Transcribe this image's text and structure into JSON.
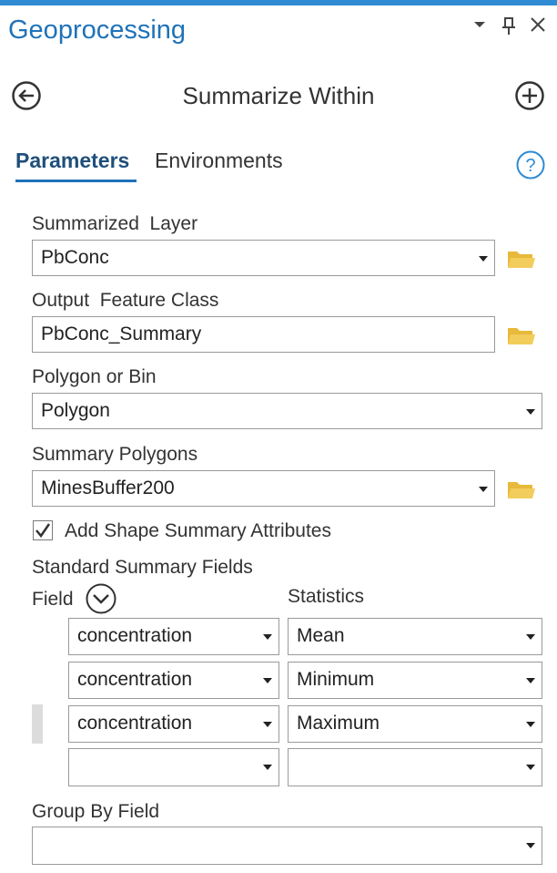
{
  "pane": {
    "title": "Geoprocessing",
    "controls": {
      "menu": "▾",
      "pin": "†",
      "close": "×"
    }
  },
  "tool": {
    "title": "Summarize Within"
  },
  "tabs": [
    {
      "label": "Parameters",
      "active": true
    },
    {
      "label": "Environments",
      "active": false
    }
  ],
  "params": {
    "summarized_layer": {
      "label": "Summarized  Layer",
      "value": "PbConc"
    },
    "output_feature_class": {
      "label": "Output  Feature Class",
      "value": "PbConc_Summary"
    },
    "polygon_or_bin": {
      "label": "Polygon or Bin",
      "value": "Polygon"
    },
    "summary_polygons": {
      "label": "Summary Polygons",
      "value": "MinesBuffer200"
    },
    "add_shape_summary": {
      "label": "Add Shape Summary Attributes",
      "checked": true
    },
    "standard_summary_fields": {
      "label": "Standard Summary Fields",
      "field_header": "Field",
      "statistics_header": "Statistics",
      "rows": [
        {
          "field": "concentration",
          "statistic": "Mean"
        },
        {
          "field": "concentration",
          "statistic": "Minimum"
        },
        {
          "field": "concentration",
          "statistic": "Maximum"
        },
        {
          "field": "",
          "statistic": ""
        }
      ]
    },
    "group_by_field": {
      "label": "Group By Field",
      "value": ""
    }
  },
  "colors": {
    "accent": "#1f72b8",
    "topbar": "#2f8bd3",
    "folder": "#e8b93a"
  },
  "icons": [
    "back-icon",
    "add-icon",
    "help-icon",
    "folder-icon",
    "chevron-down-icon",
    "checkmark-icon"
  ]
}
